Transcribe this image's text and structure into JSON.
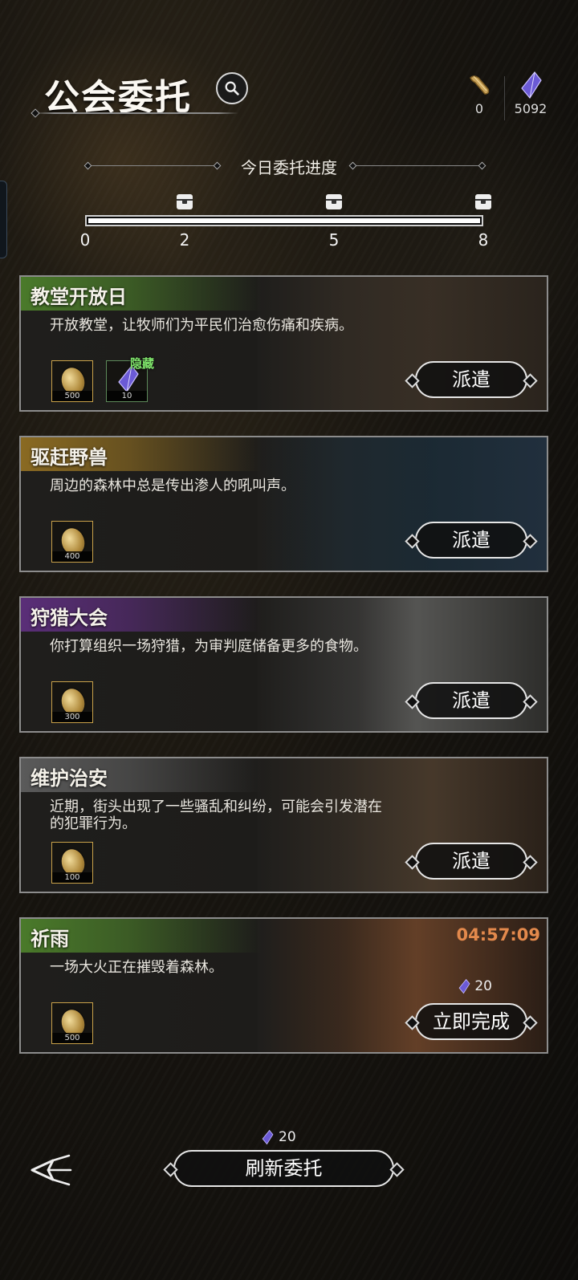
{
  "header": {
    "title": "公会委托",
    "search_icon": "magnifier-icon",
    "resources": [
      {
        "icon": "scroll-icon",
        "value": "0"
      },
      {
        "icon": "crystal-icon",
        "value": "5092"
      }
    ]
  },
  "progress": {
    "title": "今日委托进度",
    "current": 0,
    "max": 8,
    "ticks": [
      "0",
      "2",
      "5",
      "8"
    ],
    "milestones": [
      2,
      5,
      8
    ],
    "milestone_icon": "chest-icon"
  },
  "commissions": [
    {
      "name": "教堂开放日",
      "band_color": "#4a7a2a",
      "description": "开放教堂，让牧师们为平民们治愈伤痛和疾病。",
      "rewards": [
        {
          "icon": "gold-coin-icon",
          "qty": "500"
        },
        {
          "icon": "crystal-icon",
          "qty": "10",
          "tag": "隐藏"
        }
      ],
      "button": "派遣"
    },
    {
      "name": "驱赶野兽",
      "band_color": "#8a6a22",
      "description": "周边的森林中总是传出渗人的吼叫声。",
      "rewards": [
        {
          "icon": "gold-coin-icon",
          "qty": "400"
        }
      ],
      "button": "派遣"
    },
    {
      "name": "狩猎大会",
      "band_color": "#5a2e78",
      "description": "你打算组织一场狩猎，为审判庭储备更多的食物。",
      "rewards": [
        {
          "icon": "gold-coin-icon",
          "qty": "300"
        }
      ],
      "button": "派遣"
    },
    {
      "name": "维护治安",
      "band_color": "#5a5a5a",
      "description": "近期，街头出现了一些骚乱和纠纷，可能会引发潜在的犯罪行为。",
      "rewards": [
        {
          "icon": "gold-coin-icon",
          "qty": "100"
        }
      ],
      "button": "派遣"
    },
    {
      "name": "祈雨",
      "band_color": "#4a7a2a",
      "description": "一场大火正在摧毁着森林。",
      "rewards": [
        {
          "icon": "gold-coin-icon",
          "qty": "500"
        }
      ],
      "timer": "04:57:09",
      "cost": "20",
      "button": "立即完成"
    }
  ],
  "footer": {
    "back_icon": "back-arrow-icon",
    "refresh_cost": "20",
    "refresh_label": "刷新委托"
  }
}
